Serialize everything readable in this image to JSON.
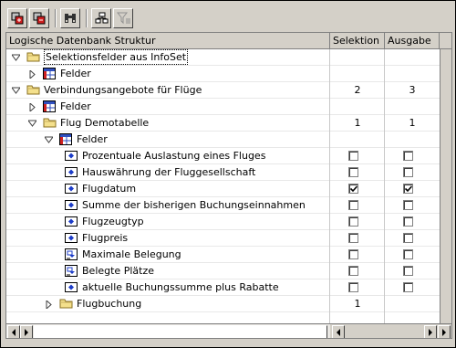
{
  "toolbar": {
    "buttons": [
      {
        "name": "expand-node-icon"
      },
      {
        "name": "collapse-node-icon"
      },
      {
        "name": "find-icon"
      },
      {
        "name": "hierarchy-icon"
      },
      {
        "name": "filter-icon"
      }
    ]
  },
  "columns": {
    "structure": "Logische Datenbank Struktur",
    "selection": "Selektion",
    "output": "Ausgabe"
  },
  "rows": [
    {
      "label": "Selektionsfelder aus InfoSet",
      "type": "folder",
      "state": "expanded",
      "focused": true
    },
    {
      "label": "Felder",
      "type": "table",
      "state": "collapsed"
    },
    {
      "label": "Verbindungsangebote für Flüge",
      "type": "folder",
      "state": "expanded",
      "selection": "2",
      "output": "3"
    },
    {
      "label": "Felder",
      "type": "table",
      "state": "collapsed"
    },
    {
      "label": "Flug Demotabelle",
      "type": "folder",
      "state": "expanded",
      "selection": "1",
      "output": "1"
    },
    {
      "label": "Felder",
      "type": "table",
      "state": "expanded"
    },
    {
      "label": "Prozentuale Auslastung eines Fluges",
      "type": "field",
      "sel_checked": false,
      "out_checked": false
    },
    {
      "label": "Hauswährung der Fluggesellschaft",
      "type": "field",
      "sel_checked": false,
      "out_checked": false
    },
    {
      "label": "Flugdatum",
      "type": "field",
      "sel_checked": true,
      "out_checked": true
    },
    {
      "label": "Summe der bisherigen Buchungseinnahmen",
      "type": "field",
      "sel_checked": false,
      "out_checked": false
    },
    {
      "label": "Flugzeugtyp",
      "type": "field",
      "sel_checked": false,
      "out_checked": false
    },
    {
      "label": "Flugpreis",
      "type": "field",
      "sel_checked": false,
      "out_checked": false
    },
    {
      "label": "Maximale Belegung",
      "type": "field-num",
      "sel_checked": false,
      "out_checked": false
    },
    {
      "label": "Belegte Plätze",
      "type": "field-num",
      "sel_checked": false,
      "out_checked": false
    },
    {
      "label": "aktuelle Buchungssumme plus Rabatte",
      "type": "field",
      "sel_checked": false,
      "out_checked": false
    },
    {
      "label": "Flugbuchung",
      "type": "folder",
      "state": "collapsed",
      "selection": "1"
    }
  ],
  "colors": {
    "window": "#d4d0c8",
    "folder": "#f4e08c",
    "field_icon": "#1c3cc8"
  }
}
